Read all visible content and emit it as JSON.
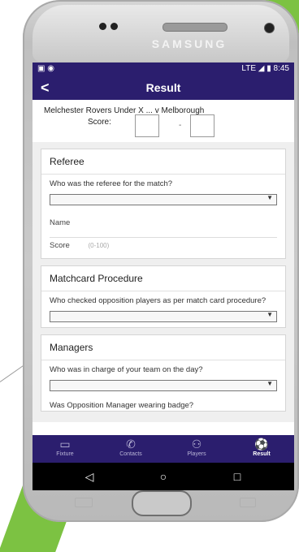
{
  "device": {
    "brand": "SAMSUNG"
  },
  "status": {
    "time": "8:45",
    "network": "LTE",
    "icons_left": "media-icons"
  },
  "appbar": {
    "title": "Result",
    "back": "<"
  },
  "match": {
    "home": "Melchester Rovers Under X ...",
    "vs": "v",
    "away": "Melborough",
    "score_label": "Score:",
    "dash": "-"
  },
  "sections": [
    {
      "title": "Referee",
      "q": "Who was the referee for the match?",
      "name_label": "Name",
      "score_label": "Score",
      "score_hint": "(0-100)"
    },
    {
      "title": "Matchcard Procedure",
      "q": "Who checked opposition players as per match card procedure?"
    },
    {
      "title": "Managers",
      "q1": "Who was in charge of your team on the day?",
      "q2": "Was Opposition Manager wearing badge?"
    }
  ],
  "nav": {
    "items": [
      {
        "label": "Fixture",
        "icon": "calendar-icon"
      },
      {
        "label": "Contacts",
        "icon": "phone-icon"
      },
      {
        "label": "Players",
        "icon": "players-icon"
      },
      {
        "label": "Result",
        "icon": "soccer-ball-icon"
      }
    ]
  },
  "system_nav": {
    "back": "◁",
    "home": "○",
    "recents": "□"
  },
  "colors": {
    "primary": "#2b1e6e",
    "accent_green": "#7cc242"
  }
}
